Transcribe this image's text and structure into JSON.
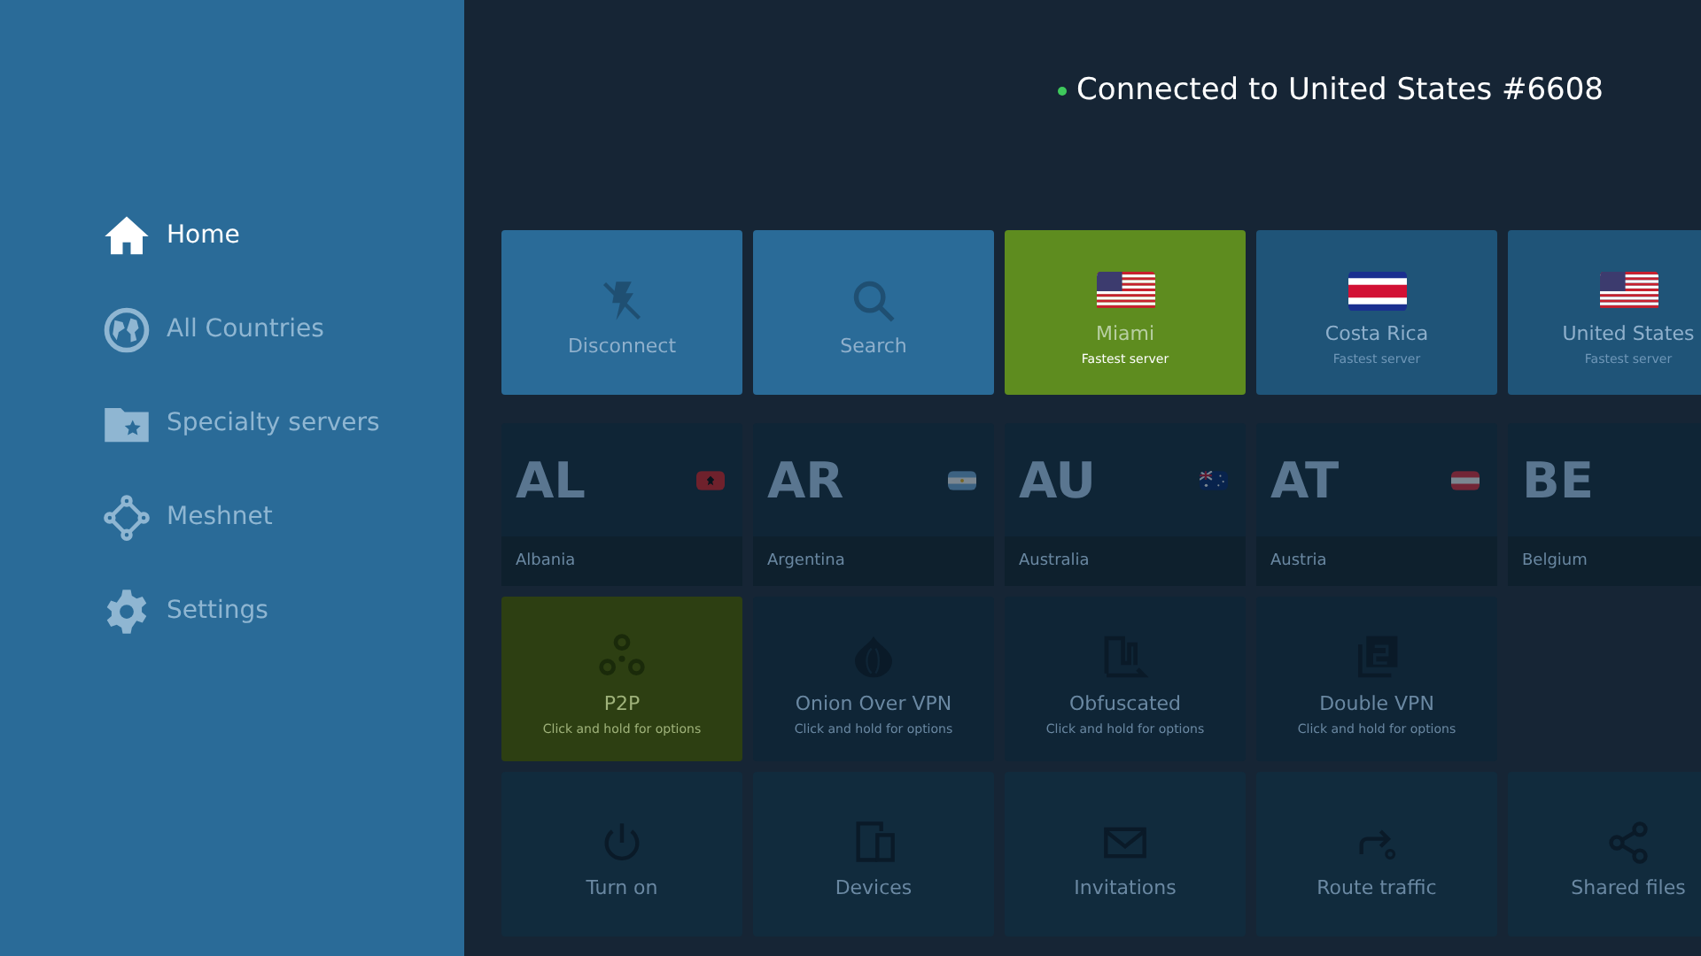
{
  "status": {
    "text": "Connected to United States #6608",
    "connected": true
  },
  "sidebar": {
    "items": [
      {
        "label": "Home",
        "selected": true
      },
      {
        "label": "All Countries",
        "selected": false
      },
      {
        "label": "Specialty servers",
        "selected": false
      },
      {
        "label": "Meshnet",
        "selected": false
      },
      {
        "label": "Settings",
        "selected": false
      }
    ]
  },
  "quick_tiles": [
    {
      "kind": "action",
      "label": "Disconnect",
      "selected": false
    },
    {
      "kind": "action",
      "label": "Search",
      "selected": false
    },
    {
      "kind": "server",
      "label": "Miami",
      "sublabel": "Fastest server",
      "selected": true
    },
    {
      "kind": "server",
      "label": "Costa Rica",
      "sublabel": "Fastest server",
      "selected": false
    },
    {
      "kind": "server",
      "label": "United States",
      "sublabel": "Fastest server",
      "selected": false
    }
  ],
  "countries": [
    {
      "code": "AL",
      "name": "Albania"
    },
    {
      "code": "AR",
      "name": "Argentina"
    },
    {
      "code": "AU",
      "name": "Australia"
    },
    {
      "code": "AT",
      "name": "Austria"
    },
    {
      "code": "BE",
      "name": "Belgium"
    }
  ],
  "specialty": [
    {
      "label": "P2P",
      "hint": "Click and hold for options",
      "selected": true
    },
    {
      "label": "Onion Over VPN",
      "hint": "Click and hold for options",
      "selected": false
    },
    {
      "label": "Obfuscated",
      "hint": "Click and hold for options",
      "selected": false
    },
    {
      "label": "Double VPN",
      "hint": "Click and hold for options",
      "selected": false
    }
  ],
  "meshnet": [
    {
      "label": "Turn on"
    },
    {
      "label": "Devices"
    },
    {
      "label": "Invitations"
    },
    {
      "label": "Route traffic"
    },
    {
      "label": "Shared files"
    }
  ]
}
